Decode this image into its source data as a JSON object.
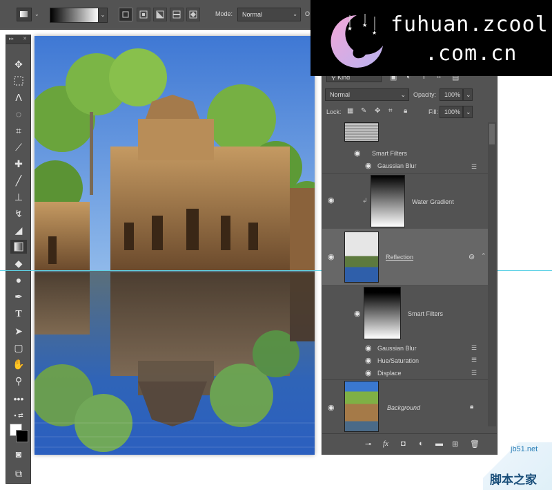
{
  "options_bar": {
    "mode_label": "Mode:",
    "mode_value": "Normal",
    "opacity_cut": "O"
  },
  "watermark": {
    "line1": "fuhuan.zcool",
    "line2": ".com.cn"
  },
  "layers": {
    "kind_label": "Kind",
    "blend_mode": "Normal",
    "opacity_label": "Opacity:",
    "opacity_value": "100%",
    "lock_label": "Lock:",
    "fill_label": "Fill:",
    "fill_value": "100%",
    "rows": {
      "smart_filters_1": "Smart Filters",
      "gaussian_blur_1": "Gaussian Blur",
      "water_gradient": "Water Gradient",
      "reflection": "Reflection",
      "smart_filters_2": "Smart Filters",
      "gaussian_blur_2": "Gaussian Blur",
      "hue_saturation": "Hue/Saturation",
      "displace": "Displace",
      "background": "Background"
    },
    "footer_fx": "fx"
  },
  "site_badge": {
    "url": "jb51.net",
    "name": "脚本之家"
  }
}
